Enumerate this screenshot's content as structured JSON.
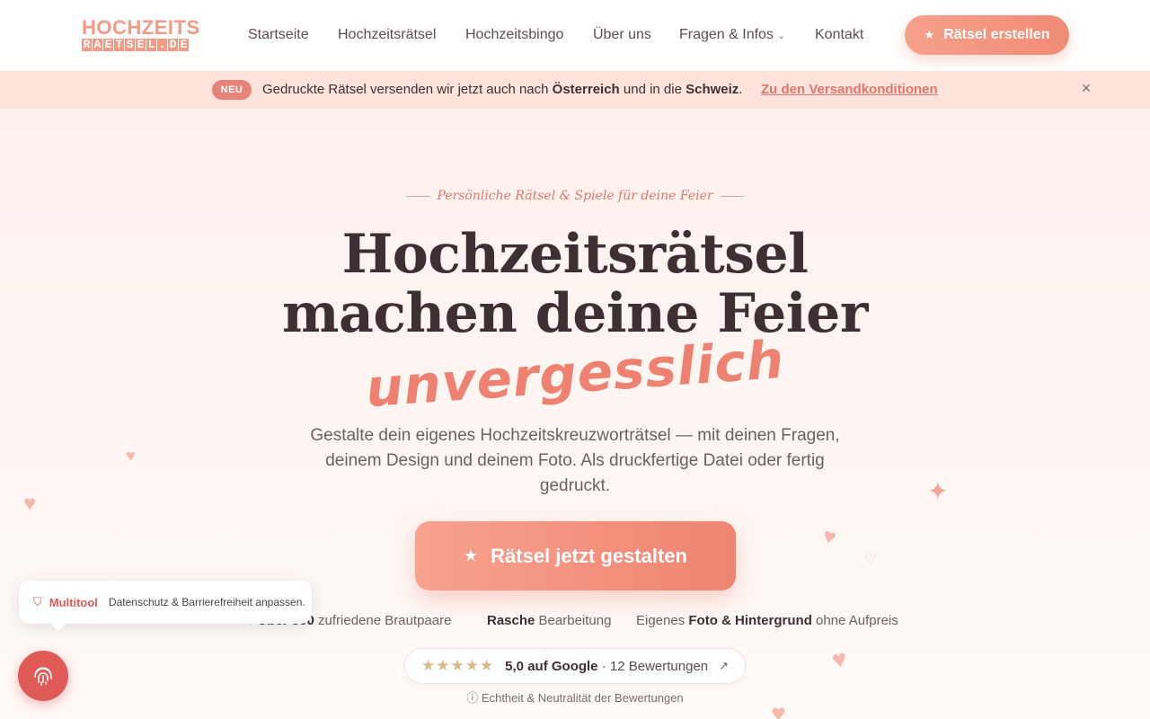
{
  "header": {
    "logo_top": "HOCHZEITS",
    "logo_bottom": [
      "R",
      "A",
      "E",
      "T",
      "S",
      "E",
      "L",
      ".",
      "D",
      "E"
    ],
    "nav": {
      "startseite": "Startseite",
      "hochzeitsraetsel": "Hochzeitsrätsel",
      "hochzeitsbingo": "Hochzeitsbingo",
      "ueber_uns": "Über uns",
      "fragen_infos": "Fragen & Infos",
      "kontakt": "Kontakt"
    },
    "cta_label": "Rätsel erstellen"
  },
  "banner": {
    "badge": "NEU",
    "text_part1": "Gedruckte Rätsel versenden wir jetzt auch nach ",
    "text_bold1": "Österreich",
    "text_part2": " und in die ",
    "text_bold2": "Schweiz",
    "text_part3": ".",
    "link": "Zu den Versandkonditionen",
    "close": "×"
  },
  "hero": {
    "tagline": "Persönliche Rätsel & Spiele für deine Feier",
    "headline_line1": "Hochzeitsrätsel",
    "headline_line2": "machen deine Feier",
    "accent_word": "unvergesslich",
    "subtext": "Gestalte dein eigenes Hochzeitskreuzworträtsel — mit deinen Fragen, deinem Design und deinem Foto. Als druckfertige Datei oder fertig gedruckt.",
    "cta_label": "Rätsel jetzt gestalten"
  },
  "benefits": {
    "b1_bold": "Über 300",
    "b1_rest": " zufriedene Brautpaare",
    "b2_bold": "Rasche",
    "b2_rest": " Bearbeitung",
    "b3_pre": "Eigenes ",
    "b3_bold": "Foto & Hintergrund",
    "b3_rest": " ohne Aufpreis"
  },
  "rating": {
    "stars": "★★★★★",
    "score": "5,0 auf Google",
    "separator": " · ",
    "count": "12 Bewertungen",
    "arrow": "↗",
    "note": "ⓘ Echtheit & Neutralität der Bewertungen"
  },
  "multitool": {
    "title": "Multitool",
    "text": "Datenschutz & Barrierefreiheit anpassen."
  },
  "colors": {
    "accent": "#ee8170",
    "brand_pink": "#f29a84",
    "banner_bg": "#fde3dc",
    "heading": "#3d2f34",
    "multitool_red": "#e05a58"
  }
}
